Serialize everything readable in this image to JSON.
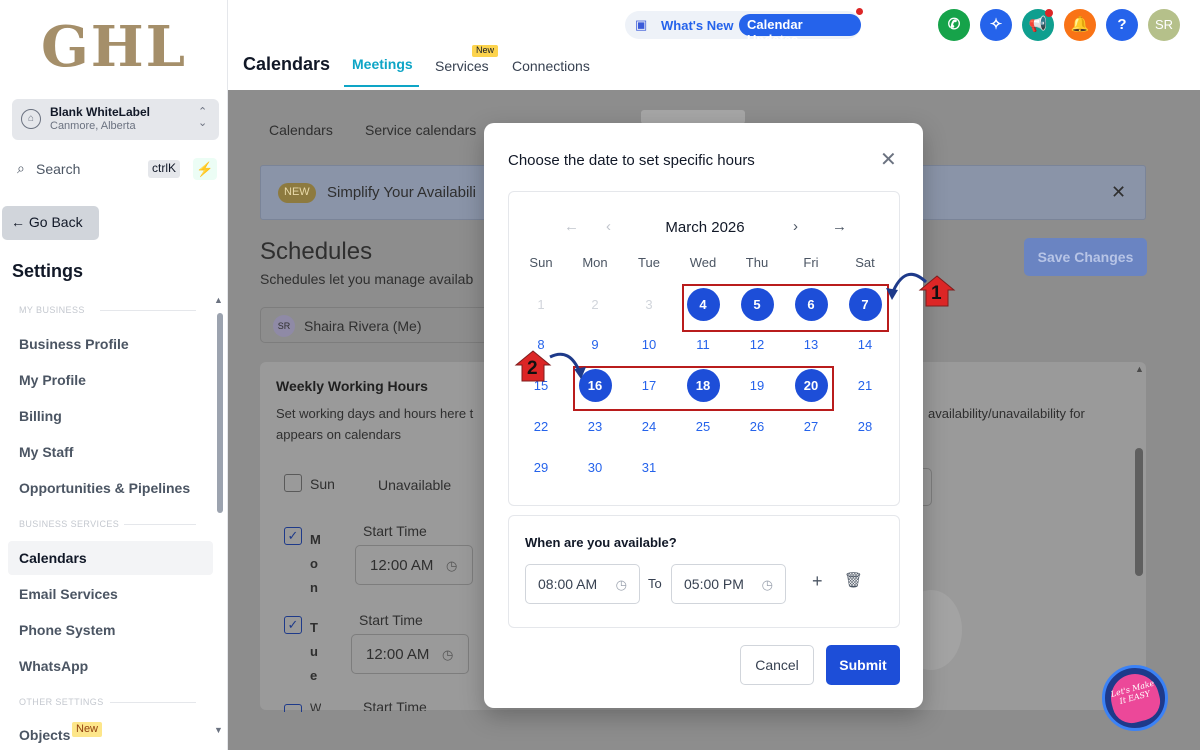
{
  "sidebar": {
    "logo": "GHL",
    "account": {
      "name": "Blank WhiteLabel",
      "location": "Canmore, Alberta"
    },
    "search": {
      "label": "Search",
      "shortcut": "ctrlK"
    },
    "go_back": "Go Back",
    "title": "Settings",
    "sections": {
      "my_business": "MY BUSINESS",
      "business_services": "BUSINESS SERVICES",
      "other_settings": "OTHER SETTINGS"
    },
    "items_my_business": [
      "Business Profile",
      "My Profile",
      "Billing",
      "My Staff",
      "Opportunities & Pipelines"
    ],
    "items_business_services": [
      "Calendars",
      "Email Services",
      "Phone System",
      "WhatsApp"
    ],
    "items_other": [
      "Objects"
    ],
    "new_tag": "New",
    "active_item": "Calendars"
  },
  "header": {
    "whats_new": "What's New",
    "calendar_updates": "Calendar Updates",
    "title": "Calendars",
    "tabs": [
      "Meetings",
      "Services",
      "Connections"
    ],
    "services_badge": "New",
    "avatar": "SR"
  },
  "background": {
    "subtabs": [
      "Calendars",
      "Service calendars"
    ],
    "banner_tag": "NEW",
    "banner_text": "Simplify Your Availabili",
    "schedules_title": "Schedules",
    "schedules_sub": "Schedules let you manage availab",
    "save_changes": "Save Changes",
    "user": {
      "initials": "SR",
      "name": "Shaira Rivera (Me)"
    },
    "weekly_title": "Weekly Working Hours",
    "weekly_desc_1": "Set working days and hours here t",
    "weekly_desc_2": "appears on calendars",
    "right_desc": "availability/unavailability for",
    "days": [
      {
        "label": "Sun",
        "status": "Unavailable"
      },
      {
        "label": "Mon",
        "start_label": "Start Time",
        "start": "12:00 AM"
      },
      {
        "label": "Tue",
        "start_label": "Start Time",
        "start": "12:00 AM"
      },
      {
        "label": "W",
        "start_label": "Start Time"
      }
    ]
  },
  "modal": {
    "title": "Choose the date to set specific hours",
    "month": "March 2026",
    "weekdays": [
      "Sun",
      "Mon",
      "Tue",
      "Wed",
      "Thu",
      "Fri",
      "Sat"
    ],
    "weeks": [
      [
        "1",
        "2",
        "3",
        "4",
        "5",
        "6",
        "7"
      ],
      [
        "8",
        "9",
        "10",
        "11",
        "12",
        "13",
        "14"
      ],
      [
        "15",
        "16",
        "17",
        "18",
        "19",
        "20",
        "21"
      ],
      [
        "22",
        "23",
        "24",
        "25",
        "26",
        "27",
        "28"
      ],
      [
        "29",
        "30",
        "31",
        "",
        "",
        "",
        ""
      ]
    ],
    "faded_days": [
      "1",
      "2",
      "3"
    ],
    "selected_days": [
      "4",
      "5",
      "6",
      "7",
      "16",
      "18",
      "20"
    ],
    "available_label": "When are you available?",
    "from": "08:00 AM",
    "to_label": "To",
    "to": "05:00 PM",
    "cancel": "Cancel",
    "submit": "Submit"
  },
  "annotations": {
    "marker_1": "1",
    "marker_2": "2"
  },
  "watermark": "Let's Make It EASY"
}
